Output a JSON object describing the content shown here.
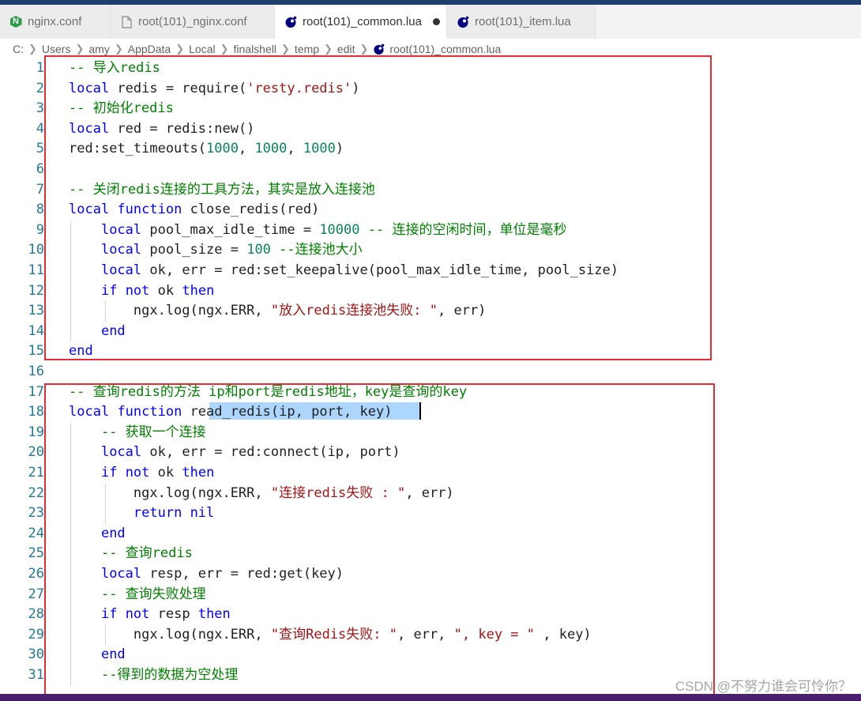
{
  "tabs": [
    {
      "label": "nginx.conf",
      "icon": "nginx-icon",
      "active": false
    },
    {
      "label": "root(101)_nginx.conf",
      "icon": "file-icon",
      "active": false
    },
    {
      "label": "root(101)_common.lua",
      "icon": "lua-icon",
      "active": true,
      "dirty": true
    },
    {
      "label": "root(101)_item.lua",
      "icon": "lua-icon",
      "active": false
    }
  ],
  "breadcrumb": [
    "C:",
    "Users",
    "amy",
    "AppData",
    "Local",
    "finalshell",
    "temp",
    "edit",
    "root(101)_common.lua"
  ],
  "code_lines": [
    {
      "n": "1",
      "text": "-- 导入redis"
    },
    {
      "n": "2",
      "text": "local redis = require('resty.redis')"
    },
    {
      "n": "3",
      "text": "-- 初始化redis"
    },
    {
      "n": "4",
      "text": "local red = redis:new()"
    },
    {
      "n": "5",
      "text": "red:set_timeouts(1000, 1000, 1000)"
    },
    {
      "n": "6",
      "text": ""
    },
    {
      "n": "7",
      "text": "-- 关闭redis连接的工具方法，其实是放入连接池"
    },
    {
      "n": "8",
      "text": "local function close_redis(red)"
    },
    {
      "n": "9",
      "text": "    local pool_max_idle_time = 10000 -- 连接的空闲时间，单位是毫秒"
    },
    {
      "n": "10",
      "text": "    local pool_size = 100 --连接池大小"
    },
    {
      "n": "11",
      "text": "    local ok, err = red:set_keepalive(pool_max_idle_time, pool_size)"
    },
    {
      "n": "12",
      "text": "    if not ok then"
    },
    {
      "n": "13",
      "text": "        ngx.log(ngx.ERR, \"放入redis连接池失败: \", err)"
    },
    {
      "n": "14",
      "text": "    end"
    },
    {
      "n": "15",
      "text": "end"
    },
    {
      "n": "16",
      "text": ""
    },
    {
      "n": "17",
      "text": "-- 查询redis的方法 ip和port是redis地址，key是查询的key"
    },
    {
      "n": "18",
      "text": "local function read_redis(ip, port, key)"
    },
    {
      "n": "19",
      "text": "    -- 获取一个连接"
    },
    {
      "n": "20",
      "text": "    local ok, err = red:connect(ip, port)"
    },
    {
      "n": "21",
      "text": "    if not ok then"
    },
    {
      "n": "22",
      "text": "        ngx.log(ngx.ERR, \"连接redis失败 : \", err)"
    },
    {
      "n": "23",
      "text": "        return nil"
    },
    {
      "n": "24",
      "text": "    end"
    },
    {
      "n": "25",
      "text": "    -- 查询redis"
    },
    {
      "n": "26",
      "text": "    local resp, err = red:get(key)"
    },
    {
      "n": "27",
      "text": "    -- 查询失败处理"
    },
    {
      "n": "28",
      "text": "    if not resp then"
    },
    {
      "n": "29",
      "text": "        ngx.log(ngx.ERR, \"查询Redis失败: \", err, \", key = \" , key)"
    },
    {
      "n": "30",
      "text": "    end"
    },
    {
      "n": "31",
      "text": "    --得到的数据为空处理"
    }
  ],
  "watermark": "CSDN @不努力谁会可怜你？",
  "colors": {
    "keyword": "#0000ff",
    "comment": "#008000",
    "string": "#a31515",
    "number": "#098658",
    "line_number": "#237893",
    "annotation_box": "#e52b36",
    "selection": "#add6ff"
  }
}
